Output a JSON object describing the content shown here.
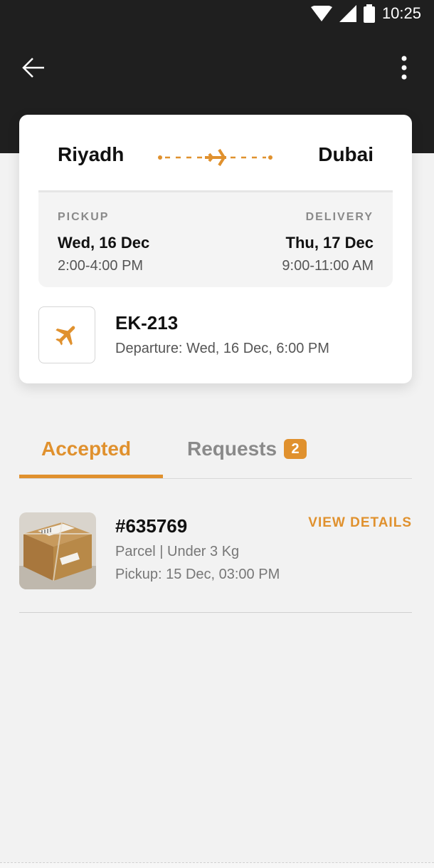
{
  "status_bar": {
    "time": "10:25",
    "icons": [
      "wifi-icon",
      "signal-icon",
      "battery-icon"
    ]
  },
  "app_bar": {
    "back_icon": "arrow-left-icon",
    "menu_icon": "more-vert-icon"
  },
  "route": {
    "from": "Riyadh",
    "to": "Dubai",
    "pickup": {
      "label": "PICKUP",
      "date": "Wed, 16 Dec",
      "time": "2:00-4:00 PM"
    },
    "delivery": {
      "label": "DELIVERY",
      "date": "Thu, 17 Dec",
      "time": "9:00-11:00 AM"
    }
  },
  "flight": {
    "number": "EK-213",
    "departure": "Departure: Wed, 16 Dec, 6:00 PM",
    "icon": "airplane-icon"
  },
  "tabs": {
    "accepted": "Accepted",
    "requests": "Requests",
    "requests_count": "2",
    "active": "accepted"
  },
  "parcels": [
    {
      "id": "#635769",
      "type": "Parcel | Under 3 Kg",
      "pickup": "Pickup: 15 Dec, 03:00 PM",
      "action": "VIEW DETAILS"
    }
  ],
  "colors": {
    "accent": "#e0912e",
    "header": "#1f1f1f",
    "background": "#f2f2f2"
  }
}
